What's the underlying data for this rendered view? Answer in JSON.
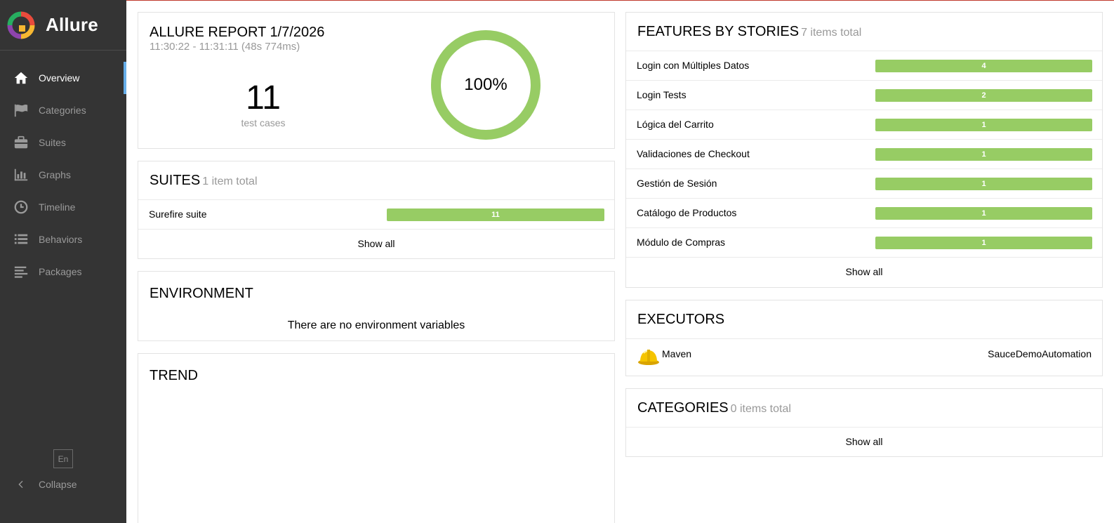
{
  "brand": {
    "name": "Allure"
  },
  "nav": {
    "items": [
      {
        "label": "Overview",
        "icon": "home-icon",
        "active": true
      },
      {
        "label": "Categories",
        "icon": "flag-icon",
        "active": false
      },
      {
        "label": "Suites",
        "icon": "briefcase-icon",
        "active": false
      },
      {
        "label": "Graphs",
        "icon": "bar-chart-icon",
        "active": false
      },
      {
        "label": "Timeline",
        "icon": "clock-icon",
        "active": false
      },
      {
        "label": "Behaviors",
        "icon": "list-icon",
        "active": false
      },
      {
        "label": "Packages",
        "icon": "align-left-icon",
        "active": false
      }
    ],
    "language": "En",
    "collapse_label": "Collapse"
  },
  "summary": {
    "title": "ALLURE REPORT 1/7/2026",
    "time": "11:30:22 - 11:31:11 (48s 774ms)",
    "count": "11",
    "count_label": "test cases",
    "percent_label": "100%",
    "pass_fraction": 1.0
  },
  "suites": {
    "title": "SUITES",
    "total": "1 item total",
    "rows": [
      {
        "label": "Surefire suite",
        "value": "11"
      }
    ],
    "show_all": "Show all"
  },
  "environment": {
    "title": "ENVIRONMENT",
    "message": "There are no environment variables"
  },
  "trend": {
    "title": "TREND"
  },
  "features": {
    "title": "FEATURES BY STORIES",
    "total": "7 items total",
    "rows": [
      {
        "label": "Login con Múltiples Datos",
        "value": "4"
      },
      {
        "label": "Login Tests",
        "value": "2"
      },
      {
        "label": "Lógica del Carrito",
        "value": "1"
      },
      {
        "label": "Validaciones de Checkout",
        "value": "1"
      },
      {
        "label": "Gestión de Sesión",
        "value": "1"
      },
      {
        "label": "Catálogo de Productos",
        "value": "1"
      },
      {
        "label": "Módulo de Compras",
        "value": "1"
      }
    ],
    "show_all": "Show all"
  },
  "executors": {
    "title": "EXECUTORS",
    "name": "Maven",
    "build": "SauceDemoAutomation"
  },
  "categories": {
    "title": "CATEGORIES",
    "total": "0 items total",
    "show_all": "Show all"
  },
  "colors": {
    "sidebar_bg": "#343434",
    "accent": "#66aee9",
    "passed": "#97cc64",
    "muted_text": "#999999"
  }
}
